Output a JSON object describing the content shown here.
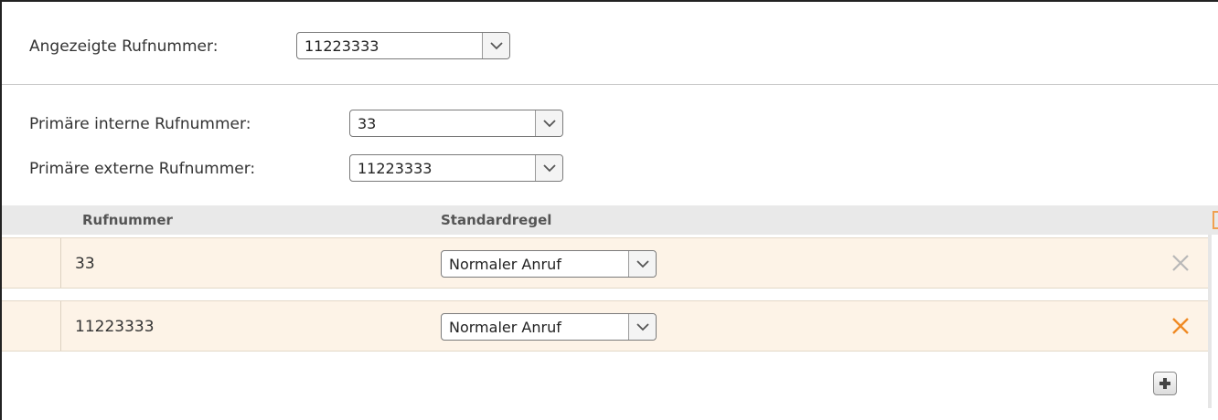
{
  "display_number": {
    "label": "Angezeigte Rufnummer:",
    "value": "11223333"
  },
  "primary": {
    "internal_label": "Primäre interne Rufnummer:",
    "internal_value": "33",
    "external_label": "Primäre externe Rufnummer:",
    "external_value": "11223333"
  },
  "table": {
    "headers": {
      "number": "Rufnummer",
      "rule": "Standardregel"
    },
    "rows": [
      {
        "number": "33",
        "rule": "Normaler Anruf",
        "delete_active": false
      },
      {
        "number": "11223333",
        "rule": "Normaler Anruf",
        "delete_active": true
      }
    ]
  },
  "colors": {
    "row_bg": "#fdf3e7",
    "delete_inactive": "#b8b8b8",
    "delete_active": "#f08a24",
    "header_bg": "#e9e9e9"
  },
  "icons": {
    "dropdown": "chevron-down-icon",
    "delete": "close-icon",
    "add": "plus-icon"
  }
}
